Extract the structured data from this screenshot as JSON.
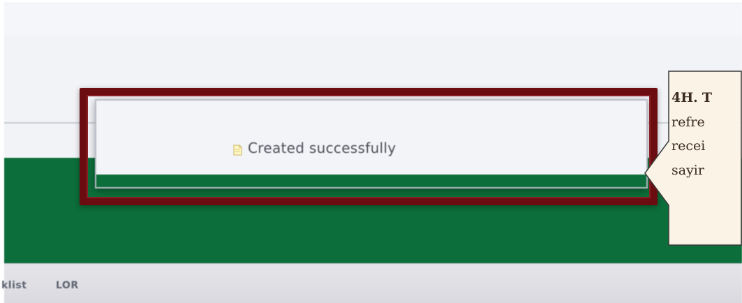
{
  "toast": {
    "message": "Created successfully",
    "icon": "note-icon"
  },
  "nav": {
    "item_1": "klist",
    "item_2": "LOR"
  },
  "callout": {
    "step_label": "4H.",
    "lines": [
      "T",
      "refre",
      "recei",
      "sayir"
    ]
  },
  "colors": {
    "highlight": "#6b0d10",
    "brand_green": "#0c6e3a",
    "callout_fill": "#fbf3e6"
  }
}
